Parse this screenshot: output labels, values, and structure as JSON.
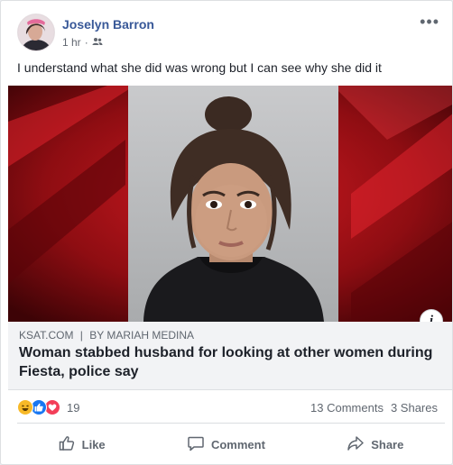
{
  "post": {
    "author": "Joselyn Barron",
    "time": "1 hr",
    "separator": "·",
    "audience_icon": "friends-icon",
    "text": "I understand what she did was wrong but I can see why she did it"
  },
  "link": {
    "source": "KSAT.COM",
    "source_separator": "|",
    "byline": "BY MARIAH MEDINA",
    "headline": "Woman stabbed husband for looking at other women during Fiesta, police say",
    "info_icon": "i"
  },
  "stats": {
    "reaction_icons": [
      "haha-icon",
      "like-icon",
      "love-icon"
    ],
    "reaction_count": "19",
    "comments": "13 Comments",
    "shares": "3 Shares"
  },
  "actions": {
    "like": "Like",
    "comment": "Comment",
    "share": "Share"
  },
  "colors": {
    "name_blue": "#385898",
    "like_blue": "#1877f2",
    "love_red": "#f33e58",
    "haha_yellow": "#f7b928",
    "media_red": "#b0121b"
  }
}
